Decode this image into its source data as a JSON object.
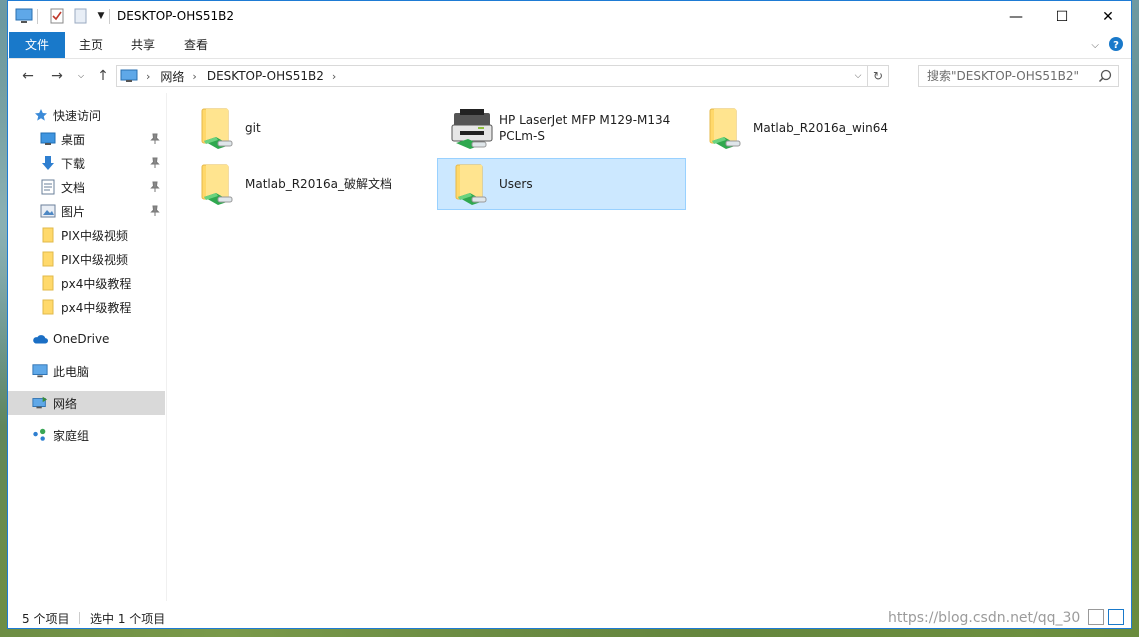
{
  "window": {
    "title": "DESKTOP-OHS51B2"
  },
  "window_controls": {
    "minimize": "—",
    "maximize": "☐",
    "close": "✕"
  },
  "ribbon": {
    "tabs": [
      {
        "label": "文件"
      },
      {
        "label": "主页"
      },
      {
        "label": "共享"
      },
      {
        "label": "查看"
      }
    ]
  },
  "address_bar": {
    "breadcrumbs": [
      "网络",
      "DESKTOP-OHS51B2"
    ]
  },
  "search": {
    "placeholder": "搜索\"DESKTOP-OHS51B2\""
  },
  "nav_pane": {
    "quick_access": "快速访问",
    "pinned": [
      {
        "label": "桌面",
        "icon": "desktop-icon"
      },
      {
        "label": "下载",
        "icon": "download-icon"
      },
      {
        "label": "文档",
        "icon": "document-icon"
      },
      {
        "label": "图片",
        "icon": "pictures-icon"
      }
    ],
    "folders": [
      {
        "label": "PIX中级视频"
      },
      {
        "label": "PIX中级视频"
      },
      {
        "label": "px4中级教程"
      },
      {
        "label": "px4中级教程"
      }
    ],
    "onedrive": "OneDrive",
    "this_pc": "此电脑",
    "network": "网络",
    "homegroup": "家庭组"
  },
  "content": {
    "items": [
      {
        "label": "git",
        "type": "shared-folder"
      },
      {
        "label_line1": "HP LaserJet MFP M129-M134",
        "label_line2": "PCLm-S",
        "type": "printer"
      },
      {
        "label": "Matlab_R2016a_win64",
        "type": "shared-folder"
      },
      {
        "label": "Matlab_R2016a_破解文档",
        "type": "shared-folder"
      },
      {
        "label": "Users",
        "type": "shared-folder",
        "selected": true
      }
    ]
  },
  "status_bar": {
    "item_count": "5 个项目",
    "selected_count": "选中 1 个项目"
  },
  "watermark": {
    "text": "https://blog.csdn.net/qq_30"
  },
  "colors": {
    "accent": "#1979ca",
    "selection_bg": "#cce8ff",
    "selection_border": "#99d1ff"
  }
}
